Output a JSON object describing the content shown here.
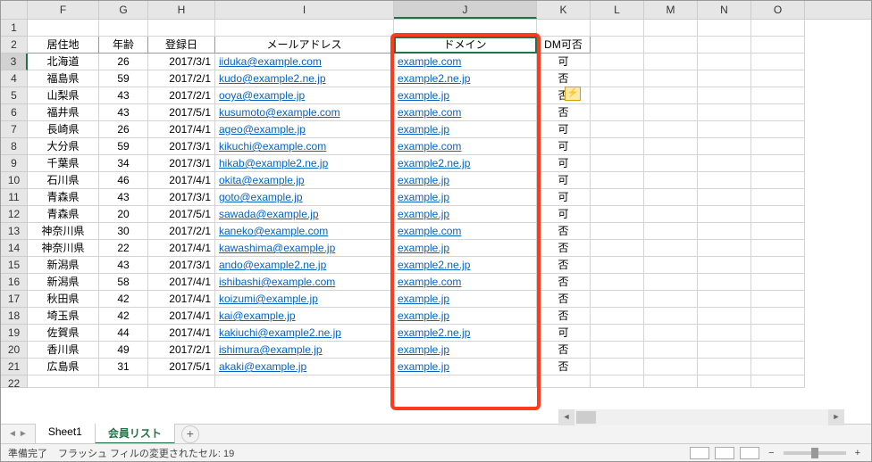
{
  "columns": [
    "F",
    "G",
    "H",
    "I",
    "J",
    "K",
    "L",
    "M",
    "N",
    "O"
  ],
  "activeCol": "J",
  "headerRow": [
    "居住地",
    "年齢",
    "登録日",
    "メールアドレス",
    "ドメイン",
    "DM可否"
  ],
  "rows": [
    {
      "n": 3,
      "f": "北海道",
      "g": 26,
      "h": "2017/3/1",
      "i": "iiduka@example.com",
      "j": "example.com",
      "k": "可"
    },
    {
      "n": 4,
      "f": "福島県",
      "g": 59,
      "h": "2017/2/1",
      "i": "kudo@example2.ne.jp",
      "j": "example2.ne.jp",
      "k": "否"
    },
    {
      "n": 5,
      "f": "山梨県",
      "g": 43,
      "h": "2017/2/1",
      "i": "ooya@example.jp",
      "j": "example.jp",
      "k": "否"
    },
    {
      "n": 6,
      "f": "福井県",
      "g": 43,
      "h": "2017/5/1",
      "i": "kusumoto@example.com",
      "j": "example.com",
      "k": "否"
    },
    {
      "n": 7,
      "f": "長崎県",
      "g": 26,
      "h": "2017/4/1",
      "i": "ageo@example.jp",
      "j": "example.jp",
      "k": "可"
    },
    {
      "n": 8,
      "f": "大分県",
      "g": 59,
      "h": "2017/3/1",
      "i": "kikuchi@example.com",
      "j": "example.com",
      "k": "可"
    },
    {
      "n": 9,
      "f": "千葉県",
      "g": 34,
      "h": "2017/3/1",
      "i": "hikab@example2.ne.jp",
      "j": "example2.ne.jp",
      "k": "可"
    },
    {
      "n": 10,
      "f": "石川県",
      "g": 46,
      "h": "2017/4/1",
      "i": "okita@example.jp",
      "j": "example.jp",
      "k": "可"
    },
    {
      "n": 11,
      "f": "青森県",
      "g": 43,
      "h": "2017/3/1",
      "i": "goto@example.jp",
      "j": "example.jp",
      "k": "可"
    },
    {
      "n": 12,
      "f": "青森県",
      "g": 20,
      "h": "2017/5/1",
      "i": "sawada@example.jp",
      "j": "example.jp",
      "k": "可"
    },
    {
      "n": 13,
      "f": "神奈川県",
      "g": 30,
      "h": "2017/2/1",
      "i": "kaneko@example.com",
      "j": "example.com",
      "k": "否"
    },
    {
      "n": 14,
      "f": "神奈川県",
      "g": 22,
      "h": "2017/4/1",
      "i": "kawashima@example.jp",
      "j": "example.jp",
      "k": "否"
    },
    {
      "n": 15,
      "f": "新潟県",
      "g": 43,
      "h": "2017/3/1",
      "i": "ando@example2.ne.jp",
      "j": "example2.ne.jp",
      "k": "否"
    },
    {
      "n": 16,
      "f": "新潟県",
      "g": 58,
      "h": "2017/4/1",
      "i": "ishibashi@example.com",
      "j": "example.com",
      "k": "否"
    },
    {
      "n": 17,
      "f": "秋田県",
      "g": 42,
      "h": "2017/4/1",
      "i": "koizumi@example.jp",
      "j": "example.jp",
      "k": "否"
    },
    {
      "n": 18,
      "f": "埼玉県",
      "g": 42,
      "h": "2017/4/1",
      "i": "kai@example.jp",
      "j": "example.jp",
      "k": "否"
    },
    {
      "n": 19,
      "f": "佐賀県",
      "g": 44,
      "h": "2017/4/1",
      "i": "kakiuchi@example2.ne.jp",
      "j": "example2.ne.jp",
      "k": "可"
    },
    {
      "n": 20,
      "f": "香川県",
      "g": 49,
      "h": "2017/2/1",
      "i": "ishimura@example.jp",
      "j": "example.jp",
      "k": "否"
    },
    {
      "n": 21,
      "f": "広島県",
      "g": 31,
      "h": "2017/5/1",
      "i": "akaki@example.jp",
      "j": "example.jp",
      "k": "否"
    }
  ],
  "sheets": [
    "Sheet1",
    "会員リスト"
  ],
  "activeSheet": 1,
  "status": {
    "ready": "準備完了",
    "flash": "フラッシュ フィルの変更されたセル: 19"
  }
}
